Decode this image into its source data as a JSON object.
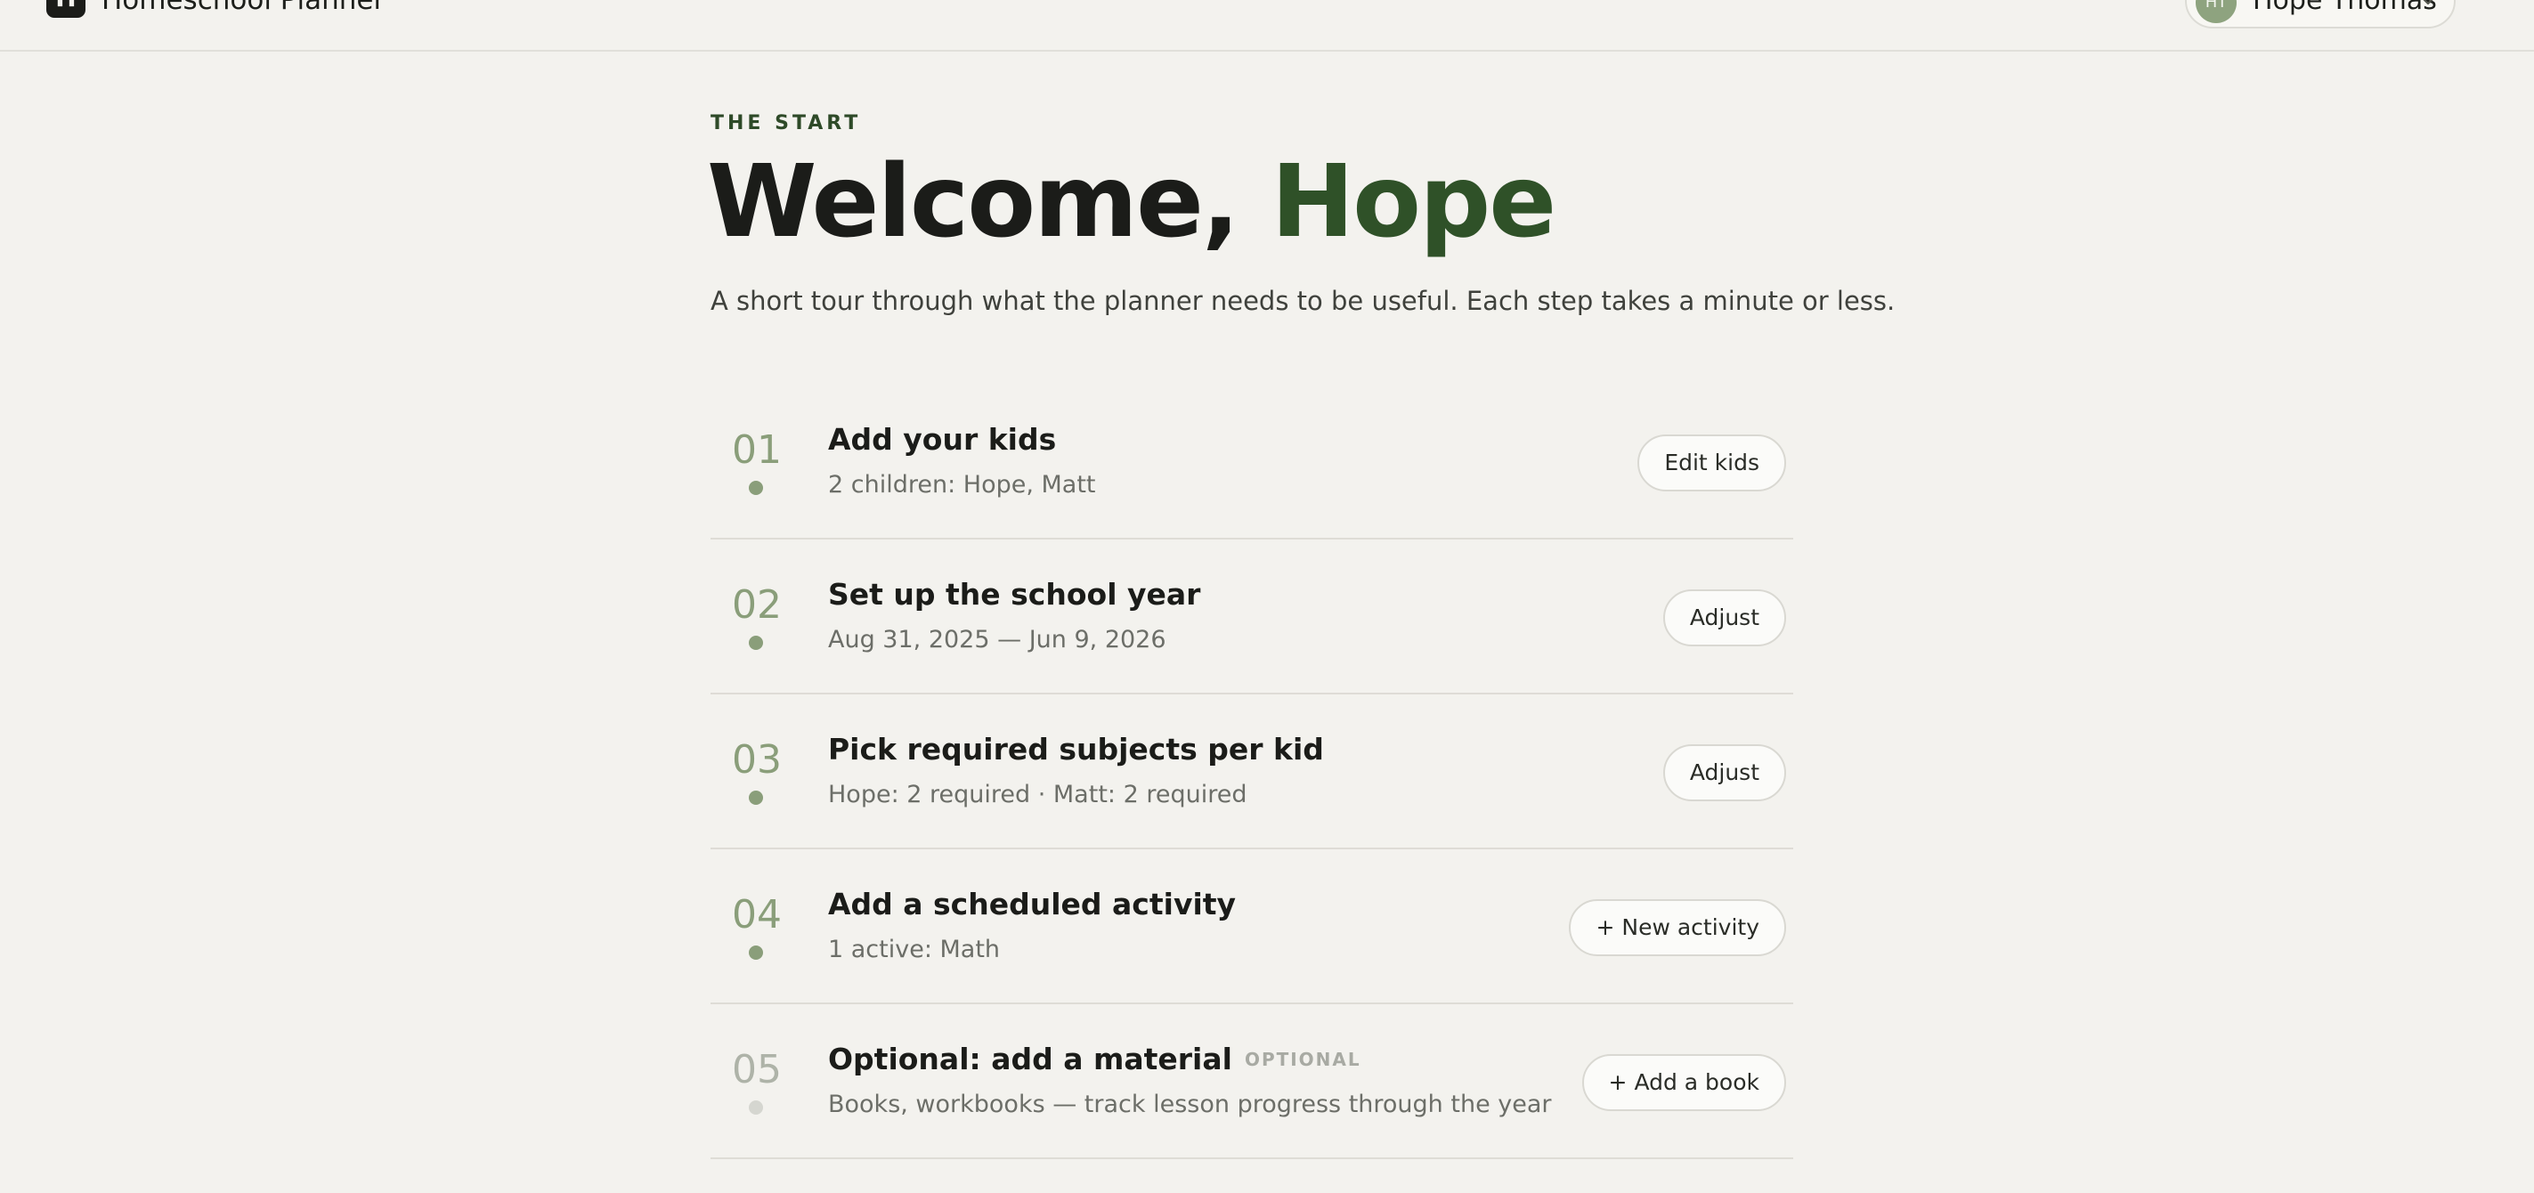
{
  "header": {
    "logo_letter": "H",
    "app_title": "Homeschool Planner",
    "user": {
      "initials": "HT",
      "name": "Hope Thomas"
    }
  },
  "intro": {
    "eyebrow": "THE START",
    "welcome_prefix": "Welcome, ",
    "welcome_name": "Hope",
    "subtitle": "A short tour through what the planner needs to be useful. Each step takes a minute or less."
  },
  "steps": [
    {
      "number": "01",
      "title": "Add your kids",
      "description": "2 children: Hope, Matt",
      "button": "Edit kids"
    },
    {
      "number": "02",
      "title": "Set up the school year",
      "description": "Aug 31, 2025 — Jun 9, 2026",
      "button": "Adjust"
    },
    {
      "number": "03",
      "title": "Pick required subjects per kid",
      "description": "Hope: 2 required · Matt: 2 required",
      "button": "Adjust"
    },
    {
      "number": "04",
      "title": "Add a scheduled activity",
      "description": "1 active: Math",
      "button": "+ New activity"
    },
    {
      "number": "05",
      "title": "Optional: add a material",
      "tag": "OPTIONAL",
      "description": "Books, workbooks — track lesson progress through the year",
      "button": "+ Add a book"
    }
  ]
}
